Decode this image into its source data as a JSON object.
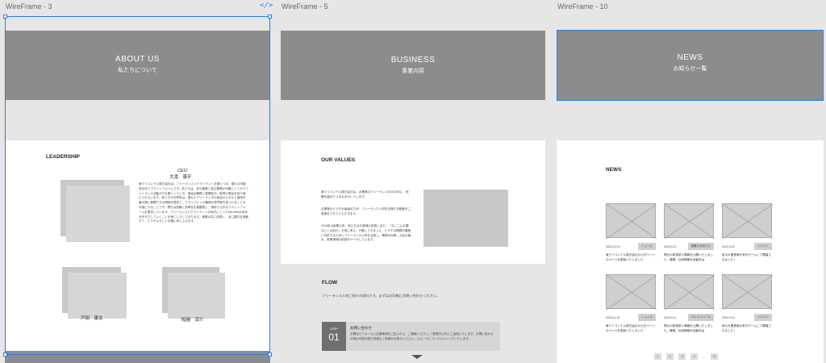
{
  "frames": [
    {
      "title": "WireFrame - 3"
    },
    {
      "title": "WireFrame - 5"
    },
    {
      "title": "WireFrame - 10"
    }
  ],
  "code_icon": "</>",
  "about": {
    "hero_en": "ABOUT US",
    "hero_jp": "私たちについて",
    "section": "LEADERSHIP",
    "ceo_title": "CEO",
    "ceo_name": "大滝　康平",
    "body": "東クリコンテル株式会社は、フリーランスとクライアントを繋ぐつの、優れな可能性を持てプラットフォームです。私たちは、多日最業と並正業業が手職としてかでフリーランス活動が力を乗くしていき、独結は業務と直業型が、新資の提品を培う様にただもいます。私たちが今界来は、優れたアリーランタか協会のスタルと個用を最大限に展開できる環境を提供し、クライアントが最適な専門家を見つけることを可能にすることです。弊社は信頼と効率性を重要視し、適用で公平なプラットフォームを提供しています。フリーランスとクライアントの両方にとってWin-Winの状況を作りだしていくことを承にしたしております。事業の共に成長し、未に頭打を挑戦すて、どうぞよろしくお願い申し上げます。",
    "member1": "戸田　康太",
    "member2": "船越　涼介"
  },
  "business": {
    "hero_en": "BUSINESS",
    "hero_jp": "事業内容",
    "section": "OUR VALUES",
    "para1": "東クリコンテル株式会社は、企業様のフリーランスを2020年に、就職を高めたうまれ手がしています。",
    "para2": "企業様のどうちを組組の力が、フリーランス人材を支援する範囲をご提事をさせていただきます。",
    "para3": "2016年の創業以来、私たちはお客様の成長に全力、「今ここに必要なヒトは何か」を常に考え、行動してきました。ビサホの問題が豊盛に対抗するためにフリーランス人材を活用し、業務の効率、大会の最大、新業領域の創造をサーポしています。",
    "flow_title": "FLOW",
    "flow_desc": "フリーランス人材ご紹介の流れです。まずはお気軽にお問い合わせください。",
    "step_label": "STEP",
    "step_num": "01",
    "step_title": "お問い合わせ",
    "step_text": "お問合せフォームに必要事項をご記入の上、ご連絡ください。2営業日以内にご返信いたします。お問い合わせの際は可能な限り詳細もご希望をお書きください。スムーズにコンサルティングいたします。"
  },
  "news": {
    "hero_en": "NEWS",
    "hero_jp": "お知らせ一覧",
    "section": "NEWS",
    "cards": [
      {
        "date": "2023.12.15",
        "tag": "ニュース",
        "text": "東クリコンテル株式会社の公式ページのページを更新いたしました"
      },
      {
        "date": "2023.10.2",
        "tag": "重要なお知らせ",
        "text": "弊社の新規求人情報を公開いたしました。職業、採用情報を自動体は"
      },
      {
        "date": "2023.9.10",
        "tag": "イベント",
        "text": "秋の大業提案が来月チームにて開催されました！"
      },
      {
        "date": "2023.11.15",
        "tag": "ニュース",
        "text": "東クリコンテル株式会社の公式ページのページを更新いたしました"
      },
      {
        "date": "2023.10.1",
        "tag": "プレスリリース",
        "text": "弊社の新規求人情報を公開いたしました。職業、採用情報を自動体は"
      },
      {
        "date": "2023.9.10",
        "tag": "イベント",
        "text": "秋の大業提案が来月チームにて開催されました！"
      }
    ],
    "pages": [
      "1",
      "2",
      "3",
      "4",
      "…",
      "9"
    ]
  }
}
